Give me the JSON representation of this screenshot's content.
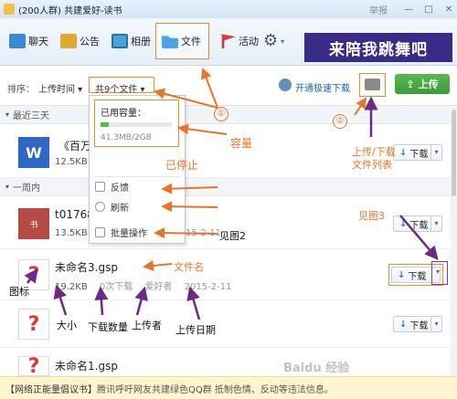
{
  "window": {
    "title": "(200人群) 共建爱好-读书",
    "report_label": "举报",
    "controls": [
      "—",
      "□",
      "✕"
    ]
  },
  "toolbar": {
    "items": [
      {
        "label": "聊天",
        "icon": "chat-icon"
      },
      {
        "label": "公告",
        "icon": "notice-icon"
      },
      {
        "label": "相册",
        "icon": "album-icon"
      },
      {
        "label": "文件",
        "icon": "folder-icon"
      },
      {
        "label": "活动",
        "icon": "flag-icon"
      }
    ],
    "more_icon": "gear-icon",
    "banner_text": "来陪我跳舞吧"
  },
  "sortbar": {
    "sort_label": "排序：",
    "sort_value": "上传时间 ▾",
    "count_label": "共9个文件 ▾",
    "fast_download": "开通极速下载",
    "upload_label": "上传"
  },
  "popup": {
    "capacity_label": "已用容量：",
    "capacity_value": "41.3MB/2GB",
    "capacity_fraction": 0.02,
    "items": [
      {
        "label": "反馈",
        "icon": "feedback-icon"
      },
      {
        "label": "刷新",
        "icon": "refresh-icon"
      },
      {
        "label": "批量操作",
        "icon": "batch-icon"
      }
    ]
  },
  "sections": {
    "recent": "最近三天",
    "week": "一周内"
  },
  "files": [
    {
      "name": "《百万",
      "size": "12.5KB",
      "downloads": "",
      "uploader": "",
      "date": "",
      "icon": "word-doc-icon",
      "button": "下载"
    },
    {
      "name": "t01768",
      "size": "13.5KB",
      "downloads": "",
      "uploader": "",
      "date": "15-2-11",
      "icon": "image-file-icon",
      "button": "下载"
    },
    {
      "name": "未命名3.gsp",
      "size": "19.2KB",
      "downloads": "0次下载",
      "uploader": "爱好者",
      "date": "2015-2-11",
      "icon": "unknown-file-icon",
      "button": "下载"
    },
    {
      "name": "",
      "size": "",
      "downloads": "",
      "uploader": "",
      "date": "",
      "icon": "unknown-file-icon",
      "button": "下载"
    },
    {
      "name": "未命名1.gsp",
      "size": "",
      "downloads": "",
      "uploader": "",
      "date": "",
      "icon": "unknown-file-icon",
      "button": "下载"
    }
  ],
  "annotations": {
    "num1": "①",
    "num2": "②",
    "capacity": "容量",
    "stopped": "已停止",
    "see_fig2": "见图2",
    "see_fig3": "见图3",
    "upload_list": "上传/下载",
    "upload_list2": "文件列表",
    "filename": "文件名",
    "icon": "图标",
    "size": "大小",
    "download_count": "下载数量",
    "uploader": "上传者",
    "upload_date": "上传日期"
  },
  "notice": {
    "prefix": "【网络正能量倡议书】",
    "text": "腾讯呼吁网友共建绿色QQ群 抵制色情、反动等违法信息。"
  },
  "watermark": "Baidu 经验 jingyan.baidu.com",
  "colors": {
    "annotation_orange": "#e8742a",
    "annotation_purple": "#6b2a86",
    "upload_green": "#4aa942",
    "link_blue": "#1a62b0"
  }
}
